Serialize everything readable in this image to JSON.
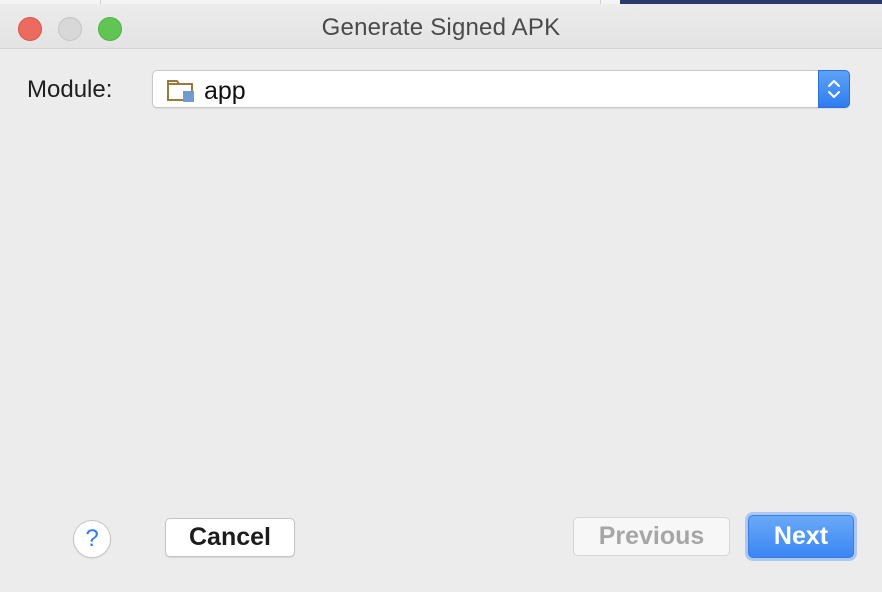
{
  "window": {
    "title": "Generate Signed APK",
    "controls": {
      "close": "close-button",
      "minimize": "minimize-button",
      "zoom": "zoom-button"
    }
  },
  "form": {
    "module_label": "Module:",
    "module_value": "app",
    "module_icon": "module-folder-icon",
    "stepper_icon": "up-down-chevron-icon"
  },
  "footer": {
    "help_label": "?",
    "cancel_label": "Cancel",
    "previous_label": "Previous",
    "next_label": "Next"
  },
  "colors": {
    "accent": "#3a86f3",
    "close": "#ed6a5e",
    "zoom": "#61c554",
    "disabled_text": "#a6a6a6"
  }
}
